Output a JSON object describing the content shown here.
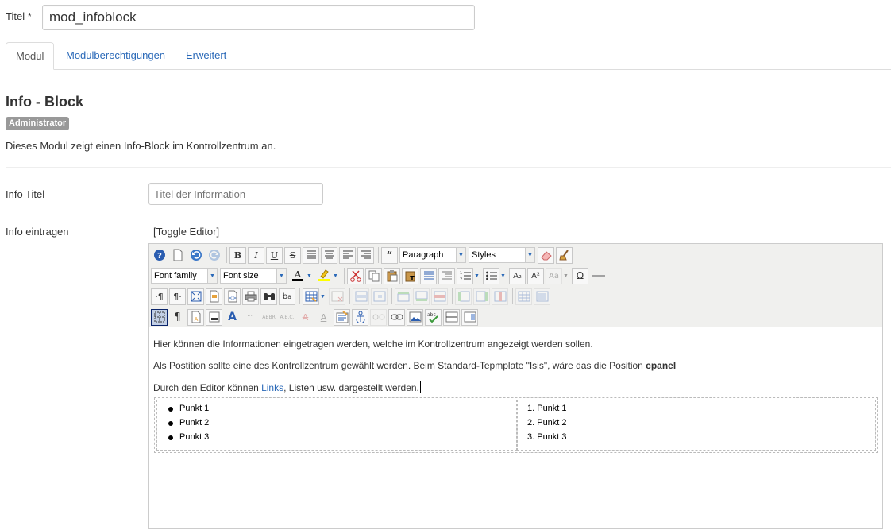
{
  "form": {
    "title_label": "Titel *",
    "title_value": "mod_infoblock"
  },
  "tabs": [
    {
      "label": "Modul",
      "active": true
    },
    {
      "label": "Modulberechtigungen",
      "active": false
    },
    {
      "label": "Erweitert",
      "active": false
    }
  ],
  "module": {
    "heading": "Info - Block",
    "badge": "Administrator",
    "description": "Dieses Modul zeigt einen Info-Block im Kontrollzentrum an."
  },
  "fields": {
    "info_title_label": "Info Titel",
    "info_title_placeholder": "Titel der Information",
    "info_content_label": "Info eintragen",
    "toggle_editor": "[Toggle Editor]"
  },
  "editor": {
    "format_select": "Paragraph",
    "styles_select": "Styles",
    "font_family_select": "Font family",
    "font_size_select": "Font size",
    "line1": "Hier können die Informationen eingetragen werden, welche im Kontrollzentrum angezeigt werden sollen.",
    "line2_text": "Als Postition sollte eine des Kontrollzentrum gewählt werden. Beim Standard-Tepmplate \"Isis\", wäre das die Position",
    "line2_bold": "cpanel",
    "line3_before": "Durch den Editor können",
    "line3_link": "Links",
    "line3_after": ", Listen usw. dargestellt werden.",
    "bullet_list": [
      "Punkt 1",
      "Punkt 2",
      "Punkt 3"
    ],
    "ordered_list": [
      "1. Punkt 1",
      "2. Punkt 2",
      "3. Punkt 3"
    ]
  }
}
